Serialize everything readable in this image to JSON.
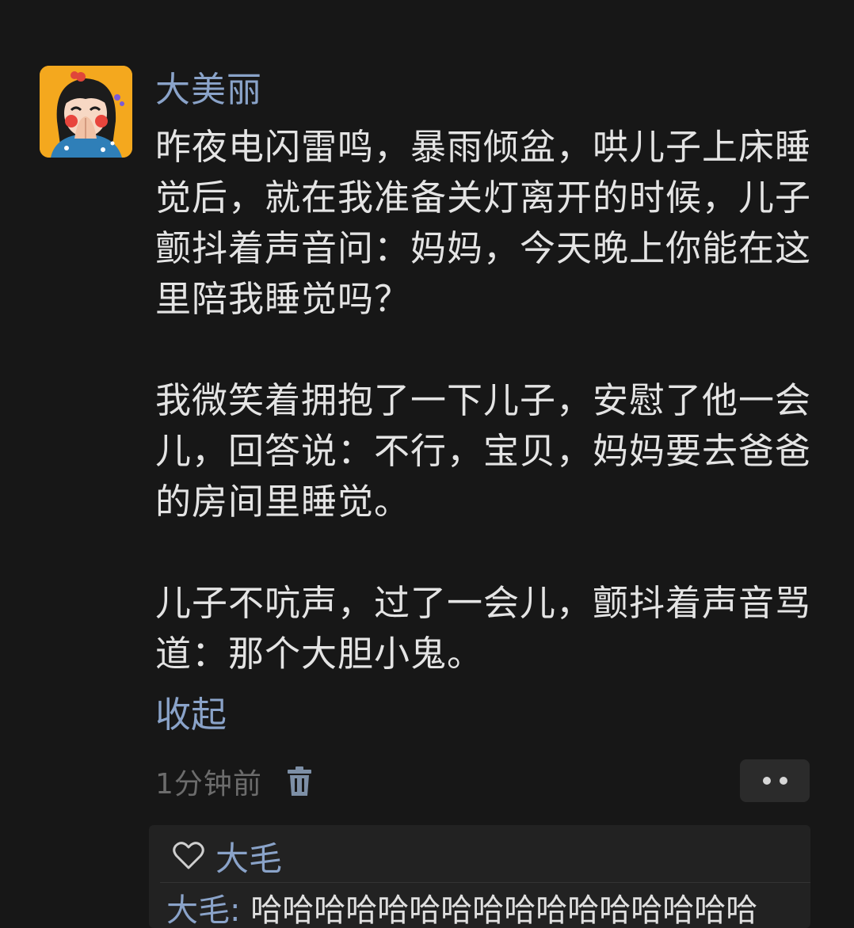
{
  "post": {
    "author": "大美丽",
    "paragraphs": [
      "昨夜电闪雷鸣，暴雨倾盆，哄儿子上床睡觉后，就在我准备关灯离开的时候，儿子颤抖着声音问：妈妈，今天晚上你能在这里陪我睡觉吗？",
      "我微笑着拥抱了一下儿子，安慰了他一会儿，回答说：不行，宝贝，妈妈要去爸爸的房间里睡觉。",
      "儿子不吭声，过了一会儿，颤抖着声音骂道：那个大胆小鬼。"
    ],
    "collapse_label": "收起",
    "time": "1分钟前"
  },
  "icons": {
    "delete": "trash-icon",
    "more": "more-dots-icon",
    "like": "heart-icon"
  },
  "likes": {
    "names": "大毛"
  },
  "reply": {
    "author": "大毛",
    "separator": ":",
    "text": "哈哈哈哈哈哈哈哈哈哈哈哈哈哈哈哈"
  },
  "colors": {
    "background": "#171717",
    "link": "#8aa3c9",
    "text": "#e4e4e4",
    "muted": "#6c6c6c"
  }
}
